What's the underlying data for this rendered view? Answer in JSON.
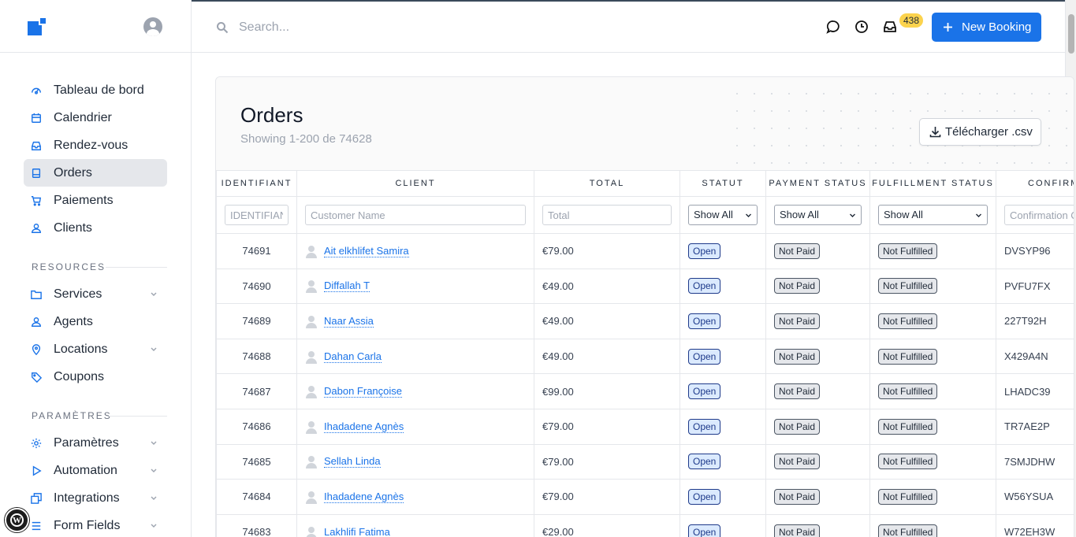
{
  "sidebar": {
    "nav": [
      {
        "label": "Tableau de bord",
        "icon": "gauge-icon"
      },
      {
        "label": "Calendrier",
        "icon": "calendar-icon"
      },
      {
        "label": "Rendez-vous",
        "icon": "inbox-icon"
      },
      {
        "label": "Orders",
        "icon": "receipt-icon",
        "active": true
      },
      {
        "label": "Paiements",
        "icon": "cart-icon"
      },
      {
        "label": "Clients",
        "icon": "user-icon"
      }
    ],
    "resources_label": "RESOURCES",
    "resources": [
      {
        "label": "Services",
        "icon": "folder-icon",
        "expandable": true
      },
      {
        "label": "Agents",
        "icon": "user-icon",
        "expandable": false
      },
      {
        "label": "Locations",
        "icon": "location-pin-icon",
        "expandable": true
      },
      {
        "label": "Coupons",
        "icon": "tag-icon",
        "expandable": false
      }
    ],
    "settings_label": "PARAMÈTRES",
    "settings": [
      {
        "label": "Paramètres",
        "icon": "gear-icon",
        "expandable": true
      },
      {
        "label": "Automation",
        "icon": "play-icon",
        "expandable": true
      },
      {
        "label": "Integrations",
        "icon": "windows-icon",
        "expandable": true
      },
      {
        "label": "Form Fields",
        "icon": "list-icon",
        "expandable": true
      }
    ]
  },
  "header": {
    "search_placeholder": "Search...",
    "notification_count": "438",
    "new_booking_label": "New Booking"
  },
  "orders": {
    "title": "Orders",
    "subtitle": "Showing 1-200 de 74628",
    "csv_label": "Télécharger .csv",
    "columns": [
      "IDENTIFIANT",
      "CLIENT",
      "TOTAL",
      "STATUT",
      "PAYMENT STATUS",
      "FULFILLMENT STATUS",
      "CONFIRMATION"
    ],
    "filters": {
      "id_placeholder": "IDENTIFIANT",
      "customer_placeholder": "Customer Name",
      "total_placeholder": "Total",
      "status_value": "Show All",
      "payment_value": "Show All",
      "fulfillment_value": "Show All",
      "confirmation_placeholder": "Confirmation Code"
    },
    "rows": [
      {
        "id": "74691",
        "client": "Ait elkhlifet Samira",
        "total": "€79.00",
        "status": "Open",
        "payment": "Not Paid",
        "fulfillment": "Not Fulfilled",
        "code": "DVSYP96"
      },
      {
        "id": "74690",
        "client": "Diffallah T",
        "total": "€49.00",
        "status": "Open",
        "payment": "Not Paid",
        "fulfillment": "Not Fulfilled",
        "code": "PVFU7FX"
      },
      {
        "id": "74689",
        "client": "Naar Assia",
        "total": "€49.00",
        "status": "Open",
        "payment": "Not Paid",
        "fulfillment": "Not Fulfilled",
        "code": "227T92H"
      },
      {
        "id": "74688",
        "client": "Dahan Carla",
        "total": "€49.00",
        "status": "Open",
        "payment": "Not Paid",
        "fulfillment": "Not Fulfilled",
        "code": "X429A4N"
      },
      {
        "id": "74687",
        "client": "Dabon Françoise",
        "total": "€99.00",
        "status": "Open",
        "payment": "Not Paid",
        "fulfillment": "Not Fulfilled",
        "code": "LHADC39"
      },
      {
        "id": "74686",
        "client": "Ihadadene Agnès",
        "total": "€79.00",
        "status": "Open",
        "payment": "Not Paid",
        "fulfillment": "Not Fulfilled",
        "code": "TR7AE2P"
      },
      {
        "id": "74685",
        "client": "Sellah Linda",
        "total": "€79.00",
        "status": "Open",
        "payment": "Not Paid",
        "fulfillment": "Not Fulfilled",
        "code": "7SMJDHW"
      },
      {
        "id": "74684",
        "client": "Ihadadene Agnès",
        "total": "€79.00",
        "status": "Open",
        "payment": "Not Paid",
        "fulfillment": "Not Fulfilled",
        "code": "W56YSUA"
      },
      {
        "id": "74683",
        "client": "Lakhlifi Fatima",
        "total": "€29.00",
        "status": "Open",
        "payment": "Not Paid",
        "fulfillment": "Not Fulfilled",
        "code": "W72EH3W"
      }
    ]
  },
  "colors": {
    "accent": "#1a73e8",
    "badge_open_bg": "#dbeafe",
    "badge_gray_bg": "#e5e7eb",
    "notif": "#fcd34d"
  }
}
